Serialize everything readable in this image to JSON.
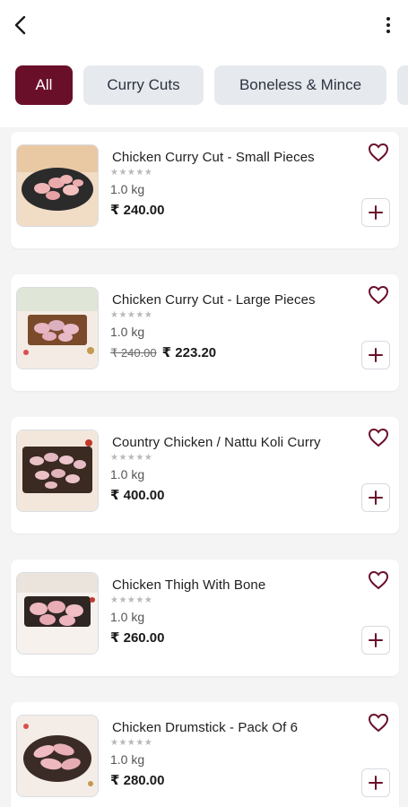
{
  "header": {
    "back_icon": "chevron-left-icon",
    "menu_icon": "more-vertical-icon"
  },
  "colors": {
    "accent": "#6a0f2a",
    "chip_idle": "#e6e9ee",
    "background": "#f4f4f4"
  },
  "categories": [
    {
      "label": "All",
      "active": true
    },
    {
      "label": "Curry Cuts",
      "active": false
    },
    {
      "label": "Boneless & Mince",
      "active": false
    }
  ],
  "products": [
    {
      "name": "Chicken Curry Cut - Small Pieces",
      "rating": "★★★★★",
      "weight": "1.0 kg",
      "mrp": "",
      "price": "₹ 240.00"
    },
    {
      "name": "Chicken Curry Cut - Large Pieces",
      "rating": "★★★★★",
      "weight": "1.0 kg",
      "mrp": "₹ 240.00",
      "price": "₹ 223.20"
    },
    {
      "name": "Country Chicken / Nattu Koli Curry",
      "rating": "★★★★★",
      "weight": "1.0 kg",
      "mrp": "",
      "price": "₹ 400.00"
    },
    {
      "name": "Chicken Thigh With Bone",
      "rating": "★★★★★",
      "weight": "1.0 kg",
      "mrp": "",
      "price": "₹ 260.00"
    },
    {
      "name": "Chicken Drumstick - Pack Of 6",
      "rating": "★★★★★",
      "weight": "1.0 kg",
      "mrp": "",
      "price": "₹ 280.00"
    }
  ]
}
